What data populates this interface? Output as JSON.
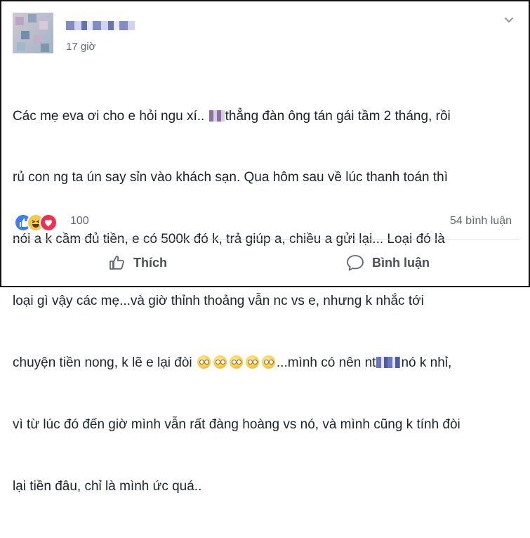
{
  "post": {
    "author_name": "",
    "timestamp": "17 giờ",
    "lines": [
      {
        "before": "Các mẹ eva ơi cho e hỏi ngu xí.. ",
        "after": "thẳng đàn ông tán gái tầm 2 tháng, rồi"
      },
      {
        "text": "rủ con ng ta ún say sỉn vào khách sạn. Qua hôm sau về lúc thanh toán thì"
      },
      {
        "text": "nói a k cầm đủ tiền, e có 500k đó k, trả giúp a, chiều a gửi lại... Loại đó là"
      },
      {
        "text": "loại gì vậy các mẹ...và giờ thỉnh thoảng vẫn nc vs e, nhưng k nhắc tới"
      },
      {
        "before": "chuyện tiền nong, k lẽ e lại đòi ",
        "middle": "...mình có nên nt",
        "after": "nó k nhỉ,"
      },
      {
        "text": "vì từ lúc đó đến giờ mình vẫn rất đàng hoàng vs nó, và mình cũng k tính đòi"
      },
      {
        "text": "lại tiền đâu, chỉ là mình ức quá.."
      }
    ],
    "emoji_count": 5,
    "emoji_name": "rolling-eyes-emoji"
  },
  "stats": {
    "reaction_icons": [
      "like-icon",
      "haha-icon",
      "love-icon"
    ],
    "reaction_count": "100",
    "comment_count": "54 bình luận"
  },
  "actions": {
    "like_label": "Thích",
    "comment_label": "Bình luận"
  },
  "colors": {
    "text": "#1d2129",
    "meta": "#616770",
    "like_blue": "#3b7cf5",
    "love_red": "#f0304f",
    "haha_yellow": "#f7c948"
  }
}
